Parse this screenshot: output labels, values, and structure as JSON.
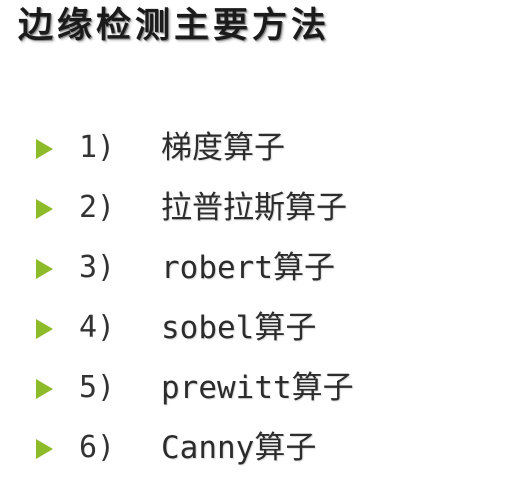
{
  "title": "边缘检测主要方法",
  "colors": {
    "bullet": "#8dbb2a",
    "text": "#2c2c2c"
  },
  "bullet_icon": "triangle-right-icon",
  "items": [
    {
      "number": "1)",
      "label": "梯度算子"
    },
    {
      "number": "2)",
      "label": "拉普拉斯算子"
    },
    {
      "number": "3)",
      "label": "robert算子"
    },
    {
      "number": "4)",
      "label": "sobel算子"
    },
    {
      "number": "5)",
      "label": "prewitt算子"
    },
    {
      "number": "6)",
      "label": "Canny算子"
    }
  ]
}
